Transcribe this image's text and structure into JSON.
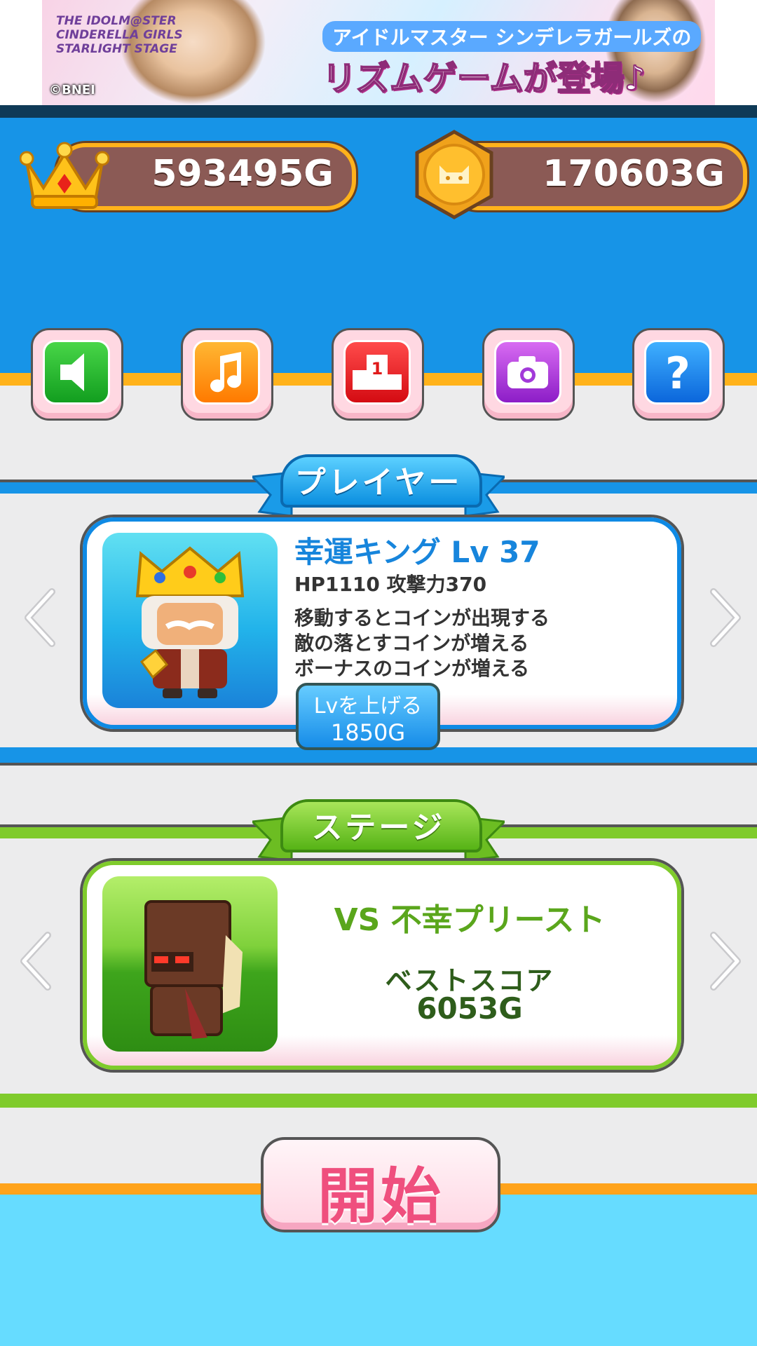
{
  "ad": {
    "logo": "THE IDOLM@STER CINDERELLA GIRLS STARLIGHT STAGE",
    "line1": "アイドルマスター シンデレラガールズの",
    "line2": "リズムゲームが登場♪",
    "copyright": "©BNEI"
  },
  "currency": {
    "crown_amount": "593495G",
    "coin_amount": "170603G",
    "crown_icon": "crown-icon",
    "coin_icon": "cat-coin-icon"
  },
  "toolbar": {
    "buttons": [
      {
        "icon": "speaker-icon",
        "color": "#1fb52a"
      },
      {
        "icon": "music-note-icon",
        "color": "#ff8a00"
      },
      {
        "icon": "ranking-podium-icon",
        "color": "#e01a1a"
      },
      {
        "icon": "camera-icon",
        "color": "#a23ad9"
      },
      {
        "icon": "question-icon",
        "color": "#1480e8"
      }
    ]
  },
  "player": {
    "section_title": "プレイヤー",
    "name": "幸運キング Lv 37",
    "stats": "HP1110 攻撃力370",
    "traits": [
      "移動するとコインが出現する",
      "敵の落とすコインが増える",
      "ボーナスのコインが増える"
    ],
    "levelup_label": "Lvを上げる",
    "levelup_cost": "1850G"
  },
  "stage": {
    "section_title": "ステージ",
    "opponent": "VS 不幸プリースト",
    "best_score_label": "ベストスコア",
    "best_score": "6053G"
  },
  "start_button": "開始",
  "colors": {
    "header_blue": "#1794e7",
    "accent_orange": "#ffb21b",
    "stage_green": "#7fcb2c",
    "start_pink": "#ef4f7e"
  }
}
